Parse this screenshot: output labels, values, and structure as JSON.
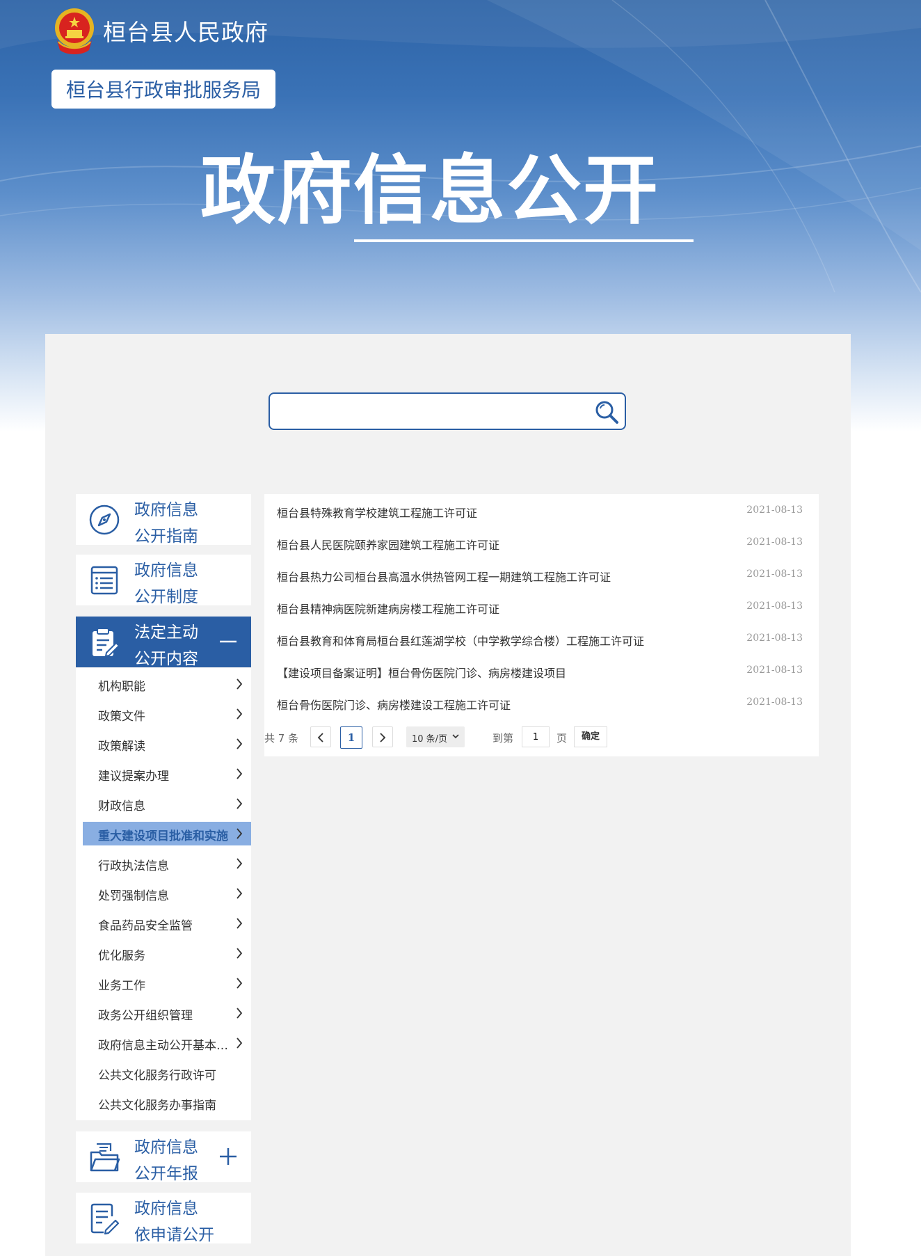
{
  "header": {
    "site_title": "桓台县人民政府",
    "department": "桓台县行政审批服务局",
    "banner_title": "政府信息公开"
  },
  "search": {
    "value": "",
    "placeholder": ""
  },
  "sidebar": {
    "menus": [
      {
        "line1": "政府信息",
        "line2": "公开指南",
        "icon": "compass-icon"
      },
      {
        "line1": "政府信息",
        "line2": "公开制度",
        "icon": "list-document-icon"
      },
      {
        "line1": "法定主动",
        "line2": "公开内容",
        "icon": "clipboard-edit-icon",
        "expanded": true
      },
      {
        "line1": "政府信息",
        "line2": "公开年报",
        "icon": "folder-icon",
        "expanded": false
      },
      {
        "line1": "政府信息",
        "line2": "依申请公开",
        "icon": "document-edit-icon"
      }
    ],
    "subitems": [
      "机构职能",
      "政策文件",
      "政策解读",
      "建议提案办理",
      "财政信息",
      "重大建设项目批准和实施",
      "行政执法信息",
      "处罚强制信息",
      "食品药品安全监管",
      "优化服务",
      "业务工作",
      "政务公开组织管理",
      "政府信息主动公开基本目录",
      "公共文化服务行政许可",
      "公共文化服务办事指南"
    ],
    "active_subitem": "重大建设项目批准和实施"
  },
  "list": [
    {
      "title": "桓台县特殊教育学校建筑工程施工许可证",
      "date": "2021-08-13"
    },
    {
      "title": "桓台县人民医院颐养家园建筑工程施工许可证",
      "date": "2021-08-13"
    },
    {
      "title": "桓台县热力公司桓台县高温水供热管网工程一期建筑工程施工许可证",
      "date": "2021-08-13"
    },
    {
      "title": "桓台县精神病医院新建病房楼工程施工许可证",
      "date": "2021-08-13"
    },
    {
      "title": "桓台县教育和体育局桓台县红莲湖学校（中学教学综合楼）工程施工许可证",
      "date": "2021-08-13"
    },
    {
      "title": "【建设项目备案证明】桓台骨伤医院门诊、病房楼建设项目",
      "date": "2021-08-13"
    },
    {
      "title": "桓台骨伤医院门诊、病房楼建设工程施工许可证",
      "date": "2021-08-13"
    }
  ],
  "pagination": {
    "total_label": "共 7 条",
    "current_page": "1",
    "page_size": "10 条/页",
    "goto_label": "到第",
    "goto_value": "1",
    "page_unit": "页",
    "confirm_label": "确定"
  },
  "colors": {
    "primary": "#2a5ea4",
    "active_sub_bg": "#89aee2",
    "panel_bg": "#f2f2f2"
  }
}
